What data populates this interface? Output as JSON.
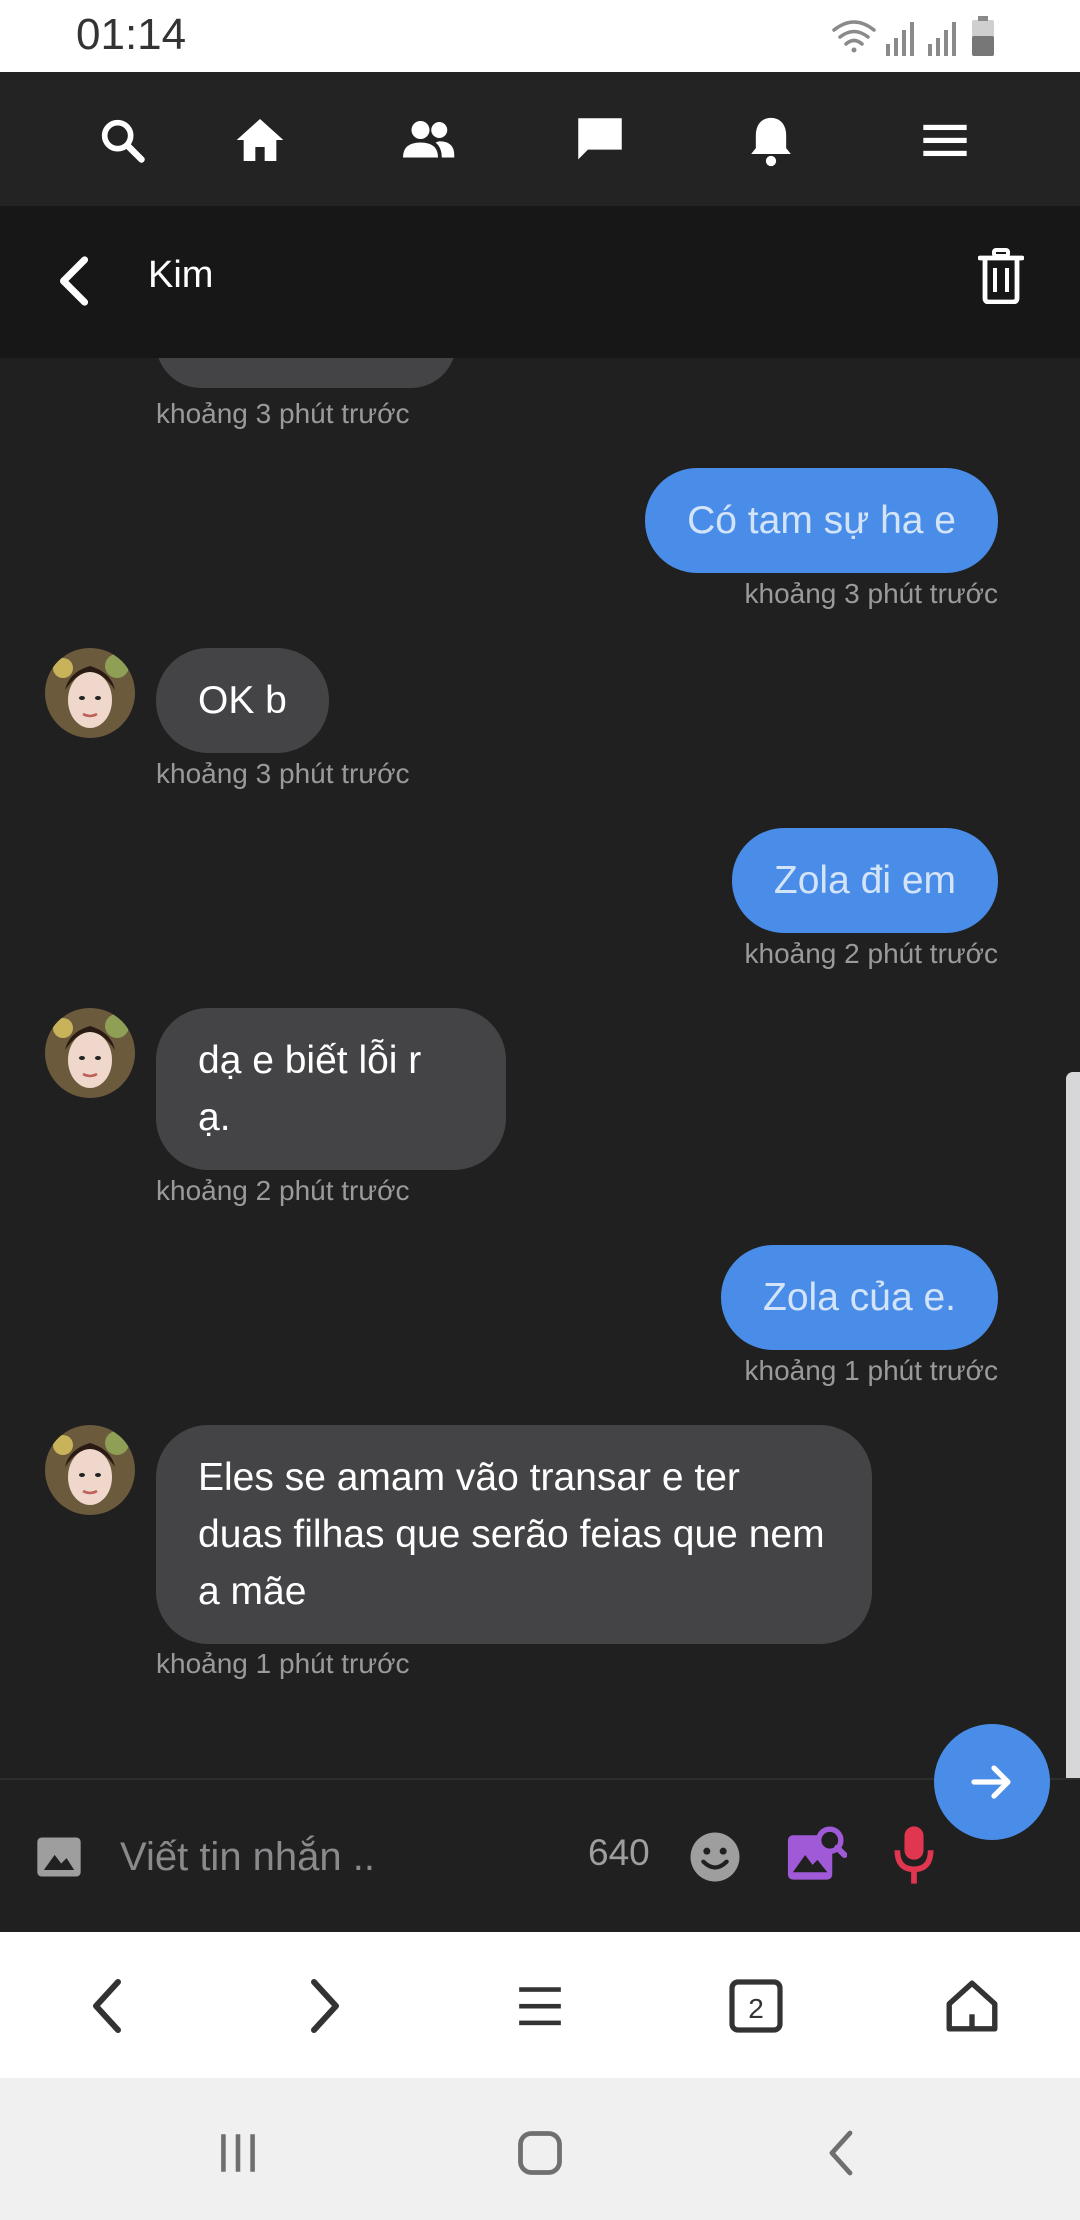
{
  "status_bar": {
    "time": "01:14"
  },
  "chat": {
    "contact_name": "Kim"
  },
  "messages": [
    {
      "direction": "in",
      "text": "",
      "timestamp": "khoảng 3 phút trước",
      "partial": true
    },
    {
      "direction": "out",
      "text": "Có tam sự ha e",
      "timestamp": "khoảng 3 phút trước"
    },
    {
      "direction": "in",
      "text": "OK b",
      "timestamp": "khoảng 3 phút trước"
    },
    {
      "direction": "out",
      "text": "Zola đi em",
      "timestamp": "khoảng 2 phút trước"
    },
    {
      "direction": "in",
      "text": "dạ e biết lỗi r ạ.",
      "timestamp": "khoảng 2 phút trước"
    },
    {
      "direction": "out",
      "text": "Zola của e.",
      "timestamp": "khoảng 1 phút trước"
    },
    {
      "direction": "in",
      "text": "Eles se amam vão transar e ter duas filhas que serão feias que nem a mãe",
      "timestamp": "khoảng 1 phút trước"
    }
  ],
  "composer": {
    "placeholder": "Viết tin nhắn ..",
    "char_count": "640"
  },
  "browser_bar": {
    "tab_count": "2"
  },
  "colors": {
    "accent": "#4a8de8",
    "mic": "#e0364f",
    "gallery": "#a05ad8"
  }
}
